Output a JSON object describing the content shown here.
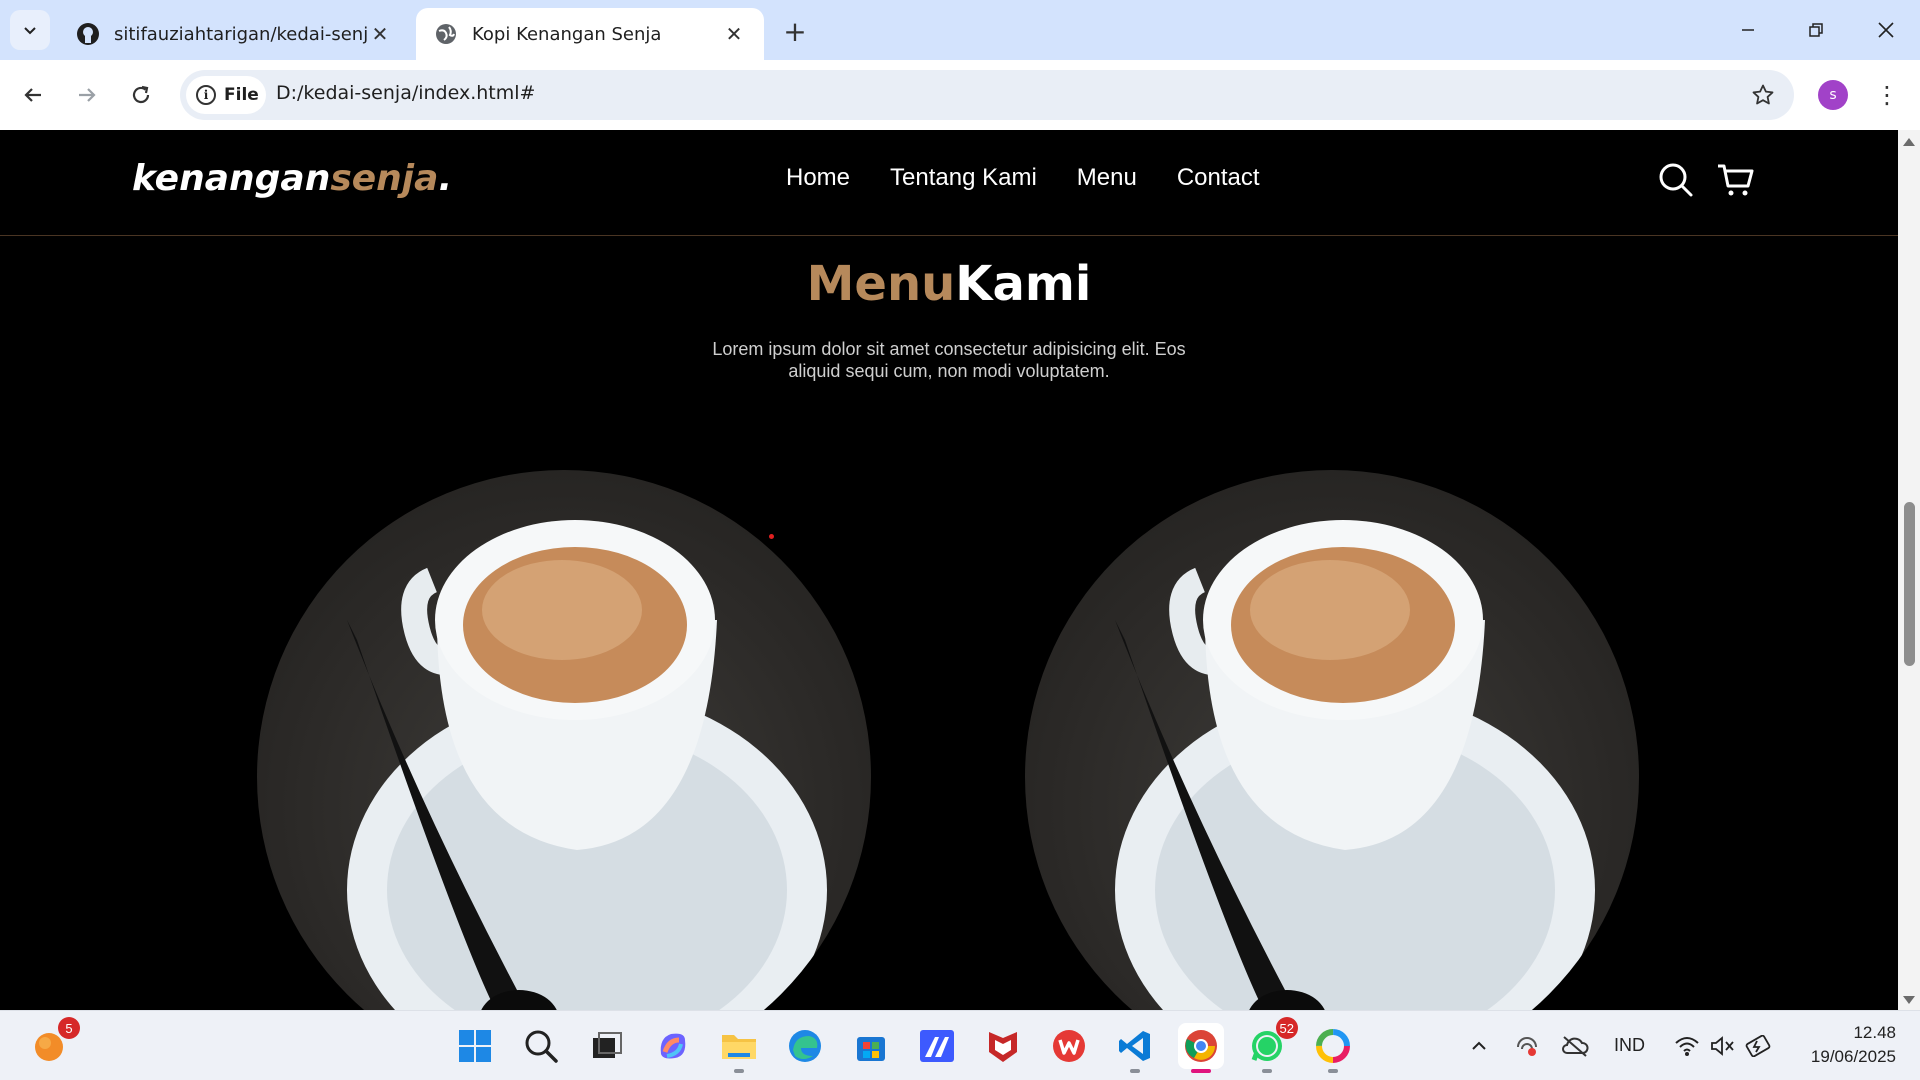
{
  "browser": {
    "tabs": [
      {
        "title": "sitifauziahtarigan/kedai-senja",
        "favicon": "github-icon",
        "active": false
      },
      {
        "title": "Kopi Kenangan Senja",
        "favicon": "globe-icon",
        "active": true
      }
    ],
    "site_chip": "File",
    "url": "D:/kedai-senja/index.html#",
    "profile_initial": "s"
  },
  "site": {
    "logo_main": "kenangan",
    "logo_accent": "senja",
    "logo_dot": ".",
    "nav": [
      "Home",
      "Tentang Kami",
      "Menu",
      "Contact"
    ],
    "section_title_accent": "Menu",
    "section_title_main": "Kami",
    "section_desc": "Lorem ipsum dolor sit amet consectetur adipisicing elit. Eos aliquid sequi cum, non modi voluptatem.",
    "accent_color": "#b6895b"
  },
  "taskbar": {
    "notification_badge": "5",
    "whatsapp_badge": "52",
    "language": "IND",
    "time": "12.48",
    "date": "19/06/2025"
  }
}
